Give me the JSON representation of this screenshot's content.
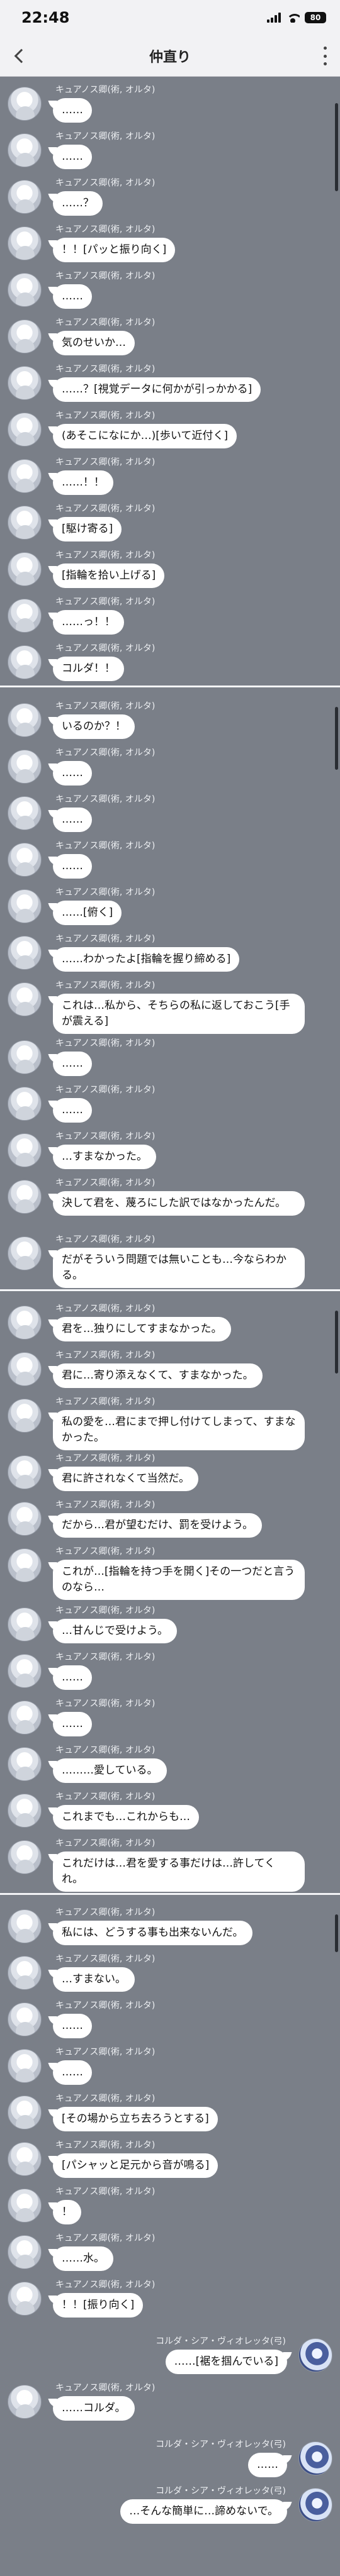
{
  "status": {
    "time": "22:48",
    "battery": "80"
  },
  "nav": {
    "title": "仲直り"
  },
  "messages": [
    {
      "sender": "キュアノス卿(術, オルタ)",
      "text": "……"
    },
    {
      "sender": "キュアノス卿(術, オルタ)",
      "text": "……"
    },
    {
      "sender": "キュアノス卿(術, オルタ)",
      "text": "……？"
    },
    {
      "sender": "キュアノス卿(術, オルタ)",
      "text": "！！[パッと振り向く]"
    },
    {
      "sender": "キュアノス卿(術, オルタ)",
      "text": "……"
    },
    {
      "sender": "キュアノス卿(術, オルタ)",
      "text": "気のせいか…"
    },
    {
      "sender": "キュアノス卿(術, オルタ)",
      "text": "……？[視覚データに何かが引っかかる]"
    },
    {
      "sender": "キュアノス卿(術, オルタ)",
      "text": "(あそこになにか…)[歩いて近付く]"
    },
    {
      "sender": "キュアノス卿(術, オルタ)",
      "text": "……！！"
    },
    {
      "sender": "キュアノス卿(術, オルタ)",
      "text": "[駆け寄る]"
    },
    {
      "sender": "キュアノス卿(術, オルタ)",
      "text": "[指輪を拾い上げる]"
    },
    {
      "sender": "キュアノス卿(術, オルタ)",
      "text": "……っ！！"
    },
    {
      "sender": "キュアノス卿(術, オルタ)",
      "text": "コルダ！！"
    },
    {
      "sender": "キュアノス卿(術, オルタ)",
      "text": "いるのか？！"
    },
    {
      "sender": "キュアノス卿(術, オルタ)",
      "text": "……"
    },
    {
      "sender": "キュアノス卿(術, オルタ)",
      "text": "……"
    },
    {
      "sender": "キュアノス卿(術, オルタ)",
      "text": "……"
    },
    {
      "sender": "キュアノス卿(術, オルタ)",
      "text": "……[俯く]"
    },
    {
      "sender": "キュアノス卿(術, オルタ)",
      "text": "……わかったよ[指輪を握り締める]"
    },
    {
      "sender": "キュアノス卿(術, オルタ)",
      "text": "これは…私から、そちらの私に返しておこう[手が震える]"
    },
    {
      "sender": "キュアノス卿(術, オルタ)",
      "text": "……"
    },
    {
      "sender": "キュアノス卿(術, オルタ)",
      "text": "……"
    },
    {
      "sender": "キュアノス卿(術, オルタ)",
      "text": "…すまなかった。"
    },
    {
      "sender": "キュアノス卿(術, オルタ)",
      "text": "決して君を、蔑ろにした訳ではなかったんだ。"
    },
    {
      "sender": "キュアノス卿(術, オルタ)",
      "text": "だがそういう問題では無いことも…今ならわかる。"
    },
    {
      "sender": "キュアノス卿(術, オルタ)",
      "text": "君を…独りにしてすまなかった。"
    },
    {
      "sender": "キュアノス卿(術, オルタ)",
      "text": "君に…寄り添えなくて、すまなかった。"
    },
    {
      "sender": "キュアノス卿(術, オルタ)",
      "text": "私の愛を…君にまで押し付けてしまって、すまなかった。"
    },
    {
      "sender": "キュアノス卿(術, オルタ)",
      "text": "君に許されなくて当然だ。"
    },
    {
      "sender": "キュアノス卿(術, オルタ)",
      "text": "だから…君が望むだけ、罰を受けよう。"
    },
    {
      "sender": "キュアノス卿(術, オルタ)",
      "text": "これが…[指輪を持つ手を開く]その一つだと言うのなら…"
    },
    {
      "sender": "キュアノス卿(術, オルタ)",
      "text": "…甘んじで受けよう。"
    },
    {
      "sender": "キュアノス卿(術, オルタ)",
      "text": "……"
    },
    {
      "sender": "キュアノス卿(術, オルタ)",
      "text": "……"
    },
    {
      "sender": "キュアノス卿(術, オルタ)",
      "text": "………愛している。"
    },
    {
      "sender": "キュアノス卿(術, オルタ)",
      "text": "これまでも…これからも…"
    },
    {
      "sender": "キュアノス卿(術, オルタ)",
      "text": "これだけは…君を愛する事だけは…許してくれ。"
    },
    {
      "sender": "キュアノス卿(術, オルタ)",
      "text": "私には、どうする事も出来ないんだ。"
    },
    {
      "sender": "キュアノス卿(術, オルタ)",
      "text": "…すまない。"
    },
    {
      "sender": "キュアノス卿(術, オルタ)",
      "text": "……"
    },
    {
      "sender": "キュアノス卿(術, オルタ)",
      "text": "……"
    },
    {
      "sender": "キュアノス卿(術, オルタ)",
      "text": "[その場から立ち去ろうとする]"
    },
    {
      "sender": "キュアノス卿(術, オルタ)",
      "text": "[パシャッと足元から音が鳴る]"
    },
    {
      "sender": "キュアノス卿(術, オルタ)",
      "text": "！"
    },
    {
      "sender": "キュアノス卿(術, オルタ)",
      "text": "……水。"
    },
    {
      "sender": "キュアノス卿(術, オルタ)",
      "text": "！！[振り向く]"
    },
    {
      "sender": "コルダ・シア・ヴィオレッタ(弓)",
      "text": "……[裾を掴んでいる]"
    },
    {
      "sender": "キュアノス卿(術, オルタ)",
      "text": "……コルダ。"
    },
    {
      "sender": "コルダ・シア・ヴィオレッタ(弓)",
      "text": "……"
    },
    {
      "sender": "コルダ・シア・ヴィオレッタ(弓)",
      "text": "…そんな簡単に…諦めないで。"
    }
  ]
}
